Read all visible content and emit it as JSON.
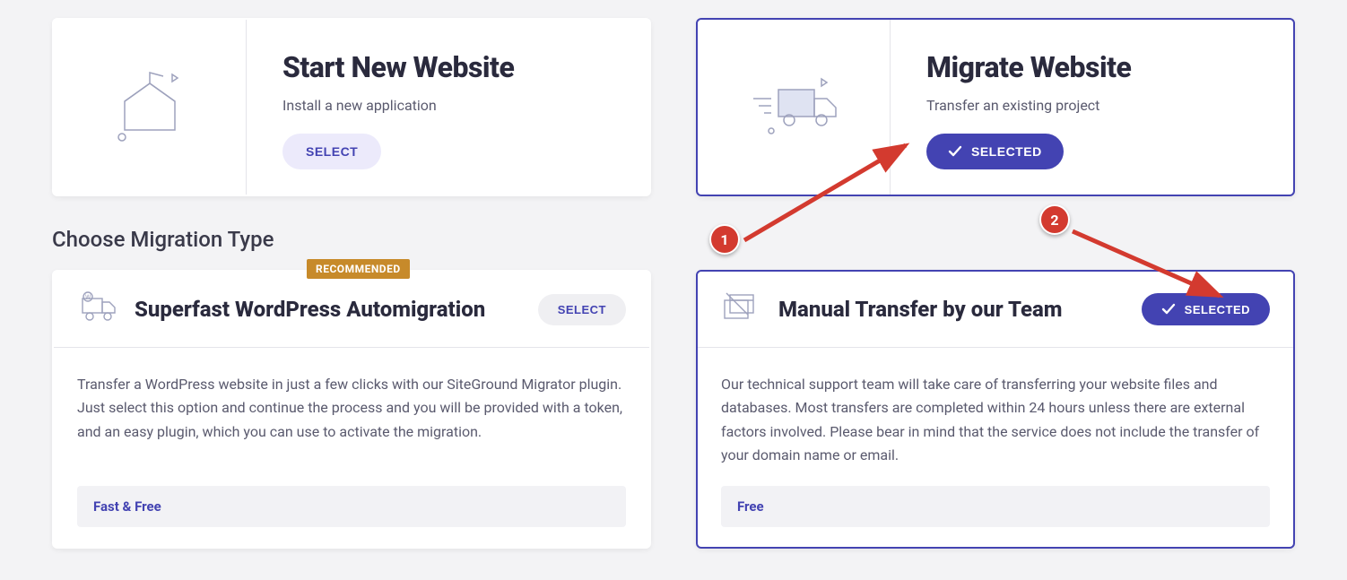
{
  "colors": {
    "accent": "#4343b2",
    "badge": "#c78a2a",
    "annotation": "#d33a2f"
  },
  "topOptions": {
    "startNew": {
      "title": "Start New Website",
      "subtitle": "Install a new application",
      "buttonLabel": "SELECT",
      "selected": false,
      "iconName": "box-house-icon"
    },
    "migrate": {
      "title": "Migrate Website",
      "subtitle": "Transfer an existing project",
      "buttonLabel": "SELECTED",
      "selected": true,
      "iconName": "moving-truck-icon"
    }
  },
  "sectionHeading": "Choose Migration Type",
  "migrationTypes": {
    "auto": {
      "badge": "RECOMMENDED",
      "title": "Superfast WordPress Automigration",
      "buttonLabel": "SELECT",
      "selected": false,
      "description": "Transfer a WordPress website in just a few clicks with our SiteGround Migrator plugin. Just select this option and continue the process and you will be provided with a token, and an easy plugin, which you can use to activate the migration.",
      "price": "Fast & Free",
      "iconName": "wordpress-truck-icon"
    },
    "manual": {
      "title": "Manual Transfer by our Team",
      "buttonLabel": "SELECTED",
      "selected": true,
      "description": "Our technical support team will take care of transferring your website files and databases. Most transfers are completed within 24 hours unless there are external factors involved. Please bear in mind that the service does not include the transfer of your domain name or email.",
      "price": "Free",
      "iconName": "wand-windows-icon"
    }
  },
  "annotations": {
    "step1": "1",
    "step2": "2"
  }
}
